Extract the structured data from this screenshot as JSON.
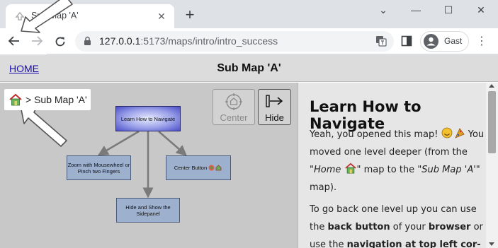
{
  "browser": {
    "tab_title": "Sub Map 'A'",
    "tab_close": "✕",
    "new_tab": "+",
    "window": {
      "minimize": "⌄",
      "restore": "—",
      "maximize": "☐",
      "close": "✕"
    },
    "url": {
      "host": "127.0.0.1",
      "rest": ":5173/maps/intro/intro_success"
    },
    "profile_label": "Gast",
    "menu": "⋮"
  },
  "header": {
    "home_link": "HOME",
    "title": "Sub Map 'A'"
  },
  "breadcrumb": {
    "text": "> Sub Map 'A'"
  },
  "map": {
    "nodes": {
      "main": "Learn How to Navigate",
      "zoom": "Zoom with Mousewheel or Pinch two Fingers",
      "center_button": "Center Button",
      "hide_show": "Hide and Show the Sidepanel"
    },
    "controls": {
      "center_label": "Center",
      "hide_label": "Hide"
    }
  },
  "sidepanel": {
    "title": "Learn How to Navigate",
    "p1": {
      "a": "Yeah, you opened this map!",
      "b": "You moved one level deeper (from the",
      "home_quote": "\"Home",
      "home_close": "\"",
      "c": "map to the",
      "sub_quote": "\"Sub Map 'A'\"",
      "d": "map)."
    },
    "p2": {
      "a": "To go back one level up you can use the",
      "back": "back button",
      "b": "of your",
      "browser": "browser",
      "c": "or use the",
      "nav": "navigation at top left cor-"
    }
  },
  "colors": {
    "node_fill": "#9db1cf",
    "map_bg": "#c8c8c8",
    "panel_bg": "#e6e6e6",
    "link": "#1a0dab"
  }
}
